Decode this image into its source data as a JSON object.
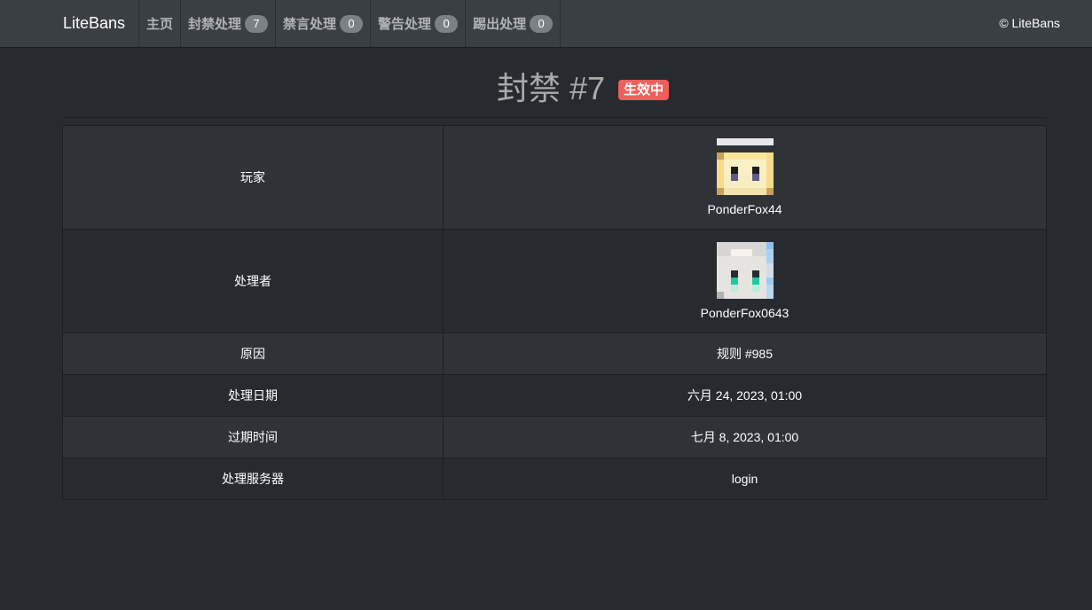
{
  "navbar": {
    "brand": "LiteBans",
    "items": [
      {
        "label": "主页",
        "count": null
      },
      {
        "label": "封禁处理",
        "count": "7"
      },
      {
        "label": "禁言处理",
        "count": "0"
      },
      {
        "label": "警告处理",
        "count": "0"
      },
      {
        "label": "踢出处理",
        "count": "0"
      }
    ],
    "copyright": "© LiteBans"
  },
  "header": {
    "title": "封禁 #7",
    "status": "生效中",
    "status_color": "#ee5f5b"
  },
  "details": {
    "player": {
      "label": "玩家",
      "name": "PonderFox44",
      "avatar": "player-skin-head-icon"
    },
    "executor": {
      "label": "处理者",
      "name": "PonderFox0643",
      "avatar": "executor-skin-head-icon"
    },
    "reason": {
      "label": "原因",
      "value": "规则 #985"
    },
    "date": {
      "label": "处理日期",
      "value": "六月 24, 2023, 01:00"
    },
    "expires": {
      "label": "过期时间",
      "value": "七月 8, 2023, 01:00"
    },
    "server": {
      "label": "处理服务器",
      "value": "login"
    }
  }
}
